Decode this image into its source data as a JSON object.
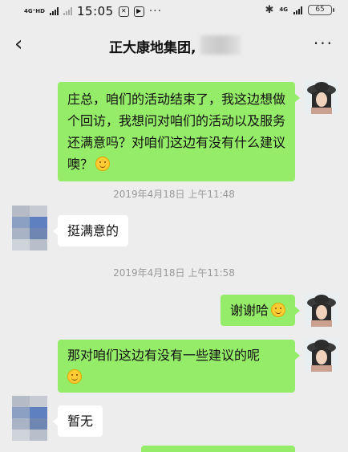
{
  "status": {
    "network": "4G⁺HD",
    "time": "15:05",
    "network_right": "4G",
    "battery": "65"
  },
  "chat": {
    "title": "正大康地集团,",
    "back_icon": "chevron-left-icon",
    "more_icon": "more-dots-icon"
  },
  "messages": [
    {
      "from": "me",
      "text": "庄总，咱们的活动结束了，我这边想做个回访，我想问对咱们的活动以及服务还满意吗？对咱们这边有没有什么建议噢？",
      "emoji": true
    },
    {
      "from": "them",
      "text": "挺满意的"
    },
    {
      "from": "me",
      "text": "谢谢哈",
      "emoji": true
    },
    {
      "from": "me",
      "text": "那对咱们这边有没有一些建议的呢",
      "emoji": true
    },
    {
      "from": "them",
      "text": "暂无"
    }
  ],
  "timestamps": [
    "2019年4月18日 上午11:48",
    "2019年4月18日 上午11:58"
  ]
}
